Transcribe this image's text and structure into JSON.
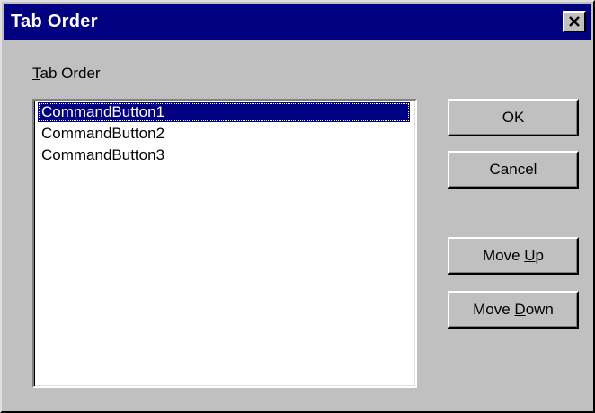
{
  "window": {
    "title": "Tab Order",
    "close_glyph": "✕"
  },
  "group": {
    "label_mnemonic": "T",
    "label_rest": "ab Order"
  },
  "list": {
    "items": [
      "CommandButton1",
      "CommandButton2",
      "CommandButton3"
    ],
    "selected_index": 0
  },
  "buttons": {
    "ok": "OK",
    "cancel": "Cancel",
    "move_up_prefix": "Move ",
    "move_up_mnemonic": "U",
    "move_up_rest": "p",
    "move_down_prefix": "Move ",
    "move_down_mnemonic": "D",
    "move_down_rest": "own"
  },
  "colors": {
    "titlebar": "#000080",
    "face": "#c0c0c0",
    "selection": "#000080"
  },
  "icons": {
    "close": "close-icon"
  }
}
